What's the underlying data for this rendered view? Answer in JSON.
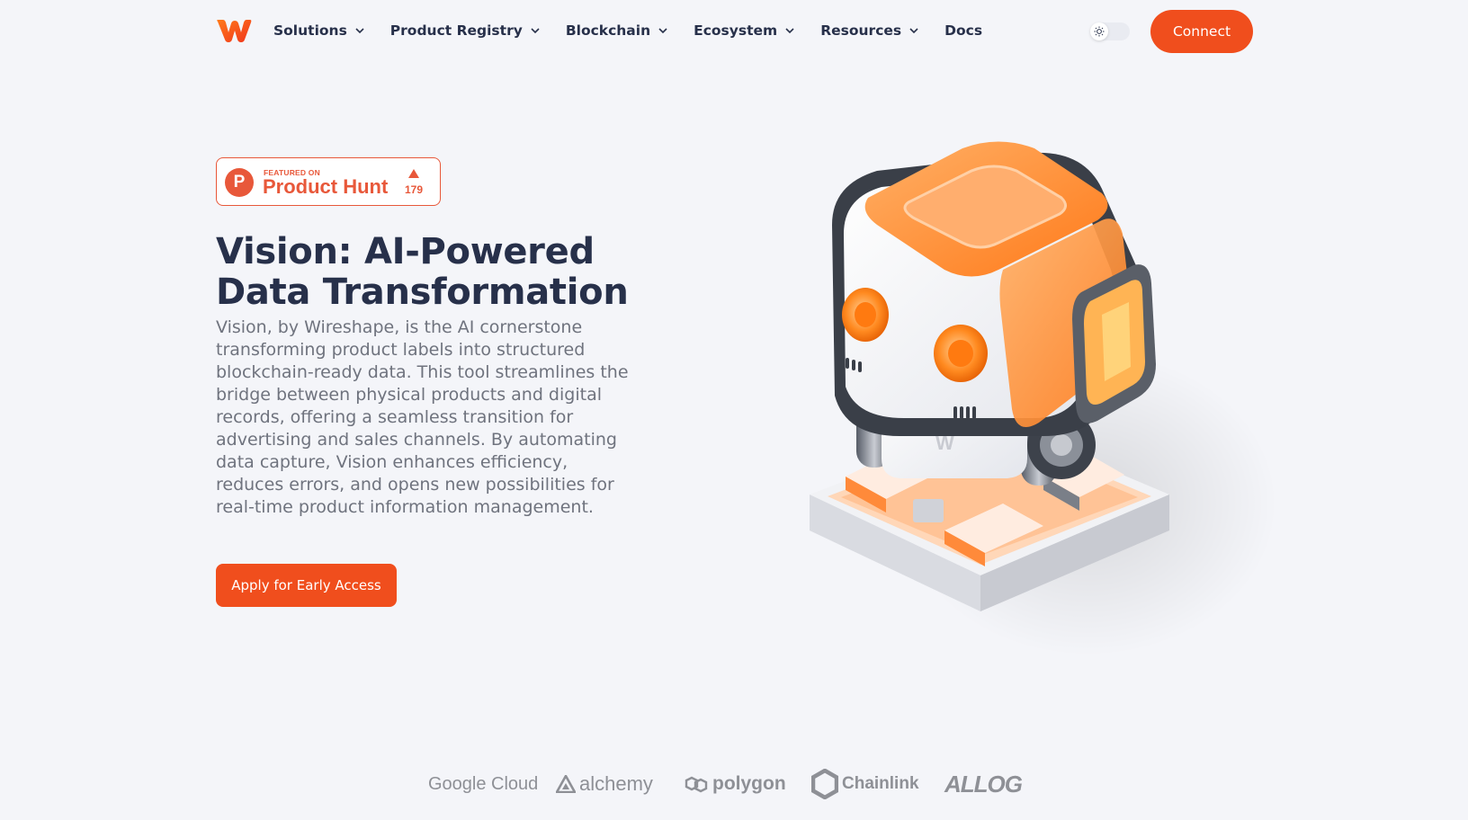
{
  "nav": {
    "logo_icon": "wireshape-logo-icon",
    "items": [
      {
        "label": "Solutions",
        "has_dropdown": true
      },
      {
        "label": "Product Registry",
        "has_dropdown": true
      },
      {
        "label": "Blockchain",
        "has_dropdown": true
      },
      {
        "label": "Ecosystem",
        "has_dropdown": true
      },
      {
        "label": "Resources",
        "has_dropdown": true
      },
      {
        "label": "Docs",
        "has_dropdown": false
      }
    ],
    "theme_toggle_icon": "sun-icon",
    "connect_label": "Connect"
  },
  "badge": {
    "featured_text": "FEATURED ON",
    "name": "Product Hunt",
    "letter": "P",
    "upvote_icon": "triangle-up-icon",
    "count": "179"
  },
  "hero": {
    "title_line1": "Vision: AI-Powered",
    "title_line2": "Data Transformation",
    "description": "Vision, by Wireshape, is the AI cornerstone transforming product labels into structured blockchain-ready data. This tool streamlines the bridge between physical products and digital records, offering a seamless transition for advertising and sales channels. By automating data capture, Vision enhances efficiency, reduces errors, and opens new possibilities for real-time product information management.",
    "cta_label": "Apply for Early Access",
    "image_icon": "robot-illustration-icon"
  },
  "partners": [
    {
      "name": "Google Cloud",
      "icon": "google-cloud-logo"
    },
    {
      "name": "alchemy",
      "icon": "alchemy-logo"
    },
    {
      "name": "polygon",
      "icon": "polygon-logo"
    },
    {
      "name": "Chainlink",
      "icon": "chainlink-logo"
    },
    {
      "name": "ALLOG",
      "icon": "allog-logo"
    }
  ],
  "colors": {
    "accent": "#f04e1d",
    "product_hunt": "#e8583a",
    "background": "#f4f5f9",
    "heading": "#27304a",
    "body_text": "#6f737e",
    "partner_gray": "#8e9096"
  }
}
